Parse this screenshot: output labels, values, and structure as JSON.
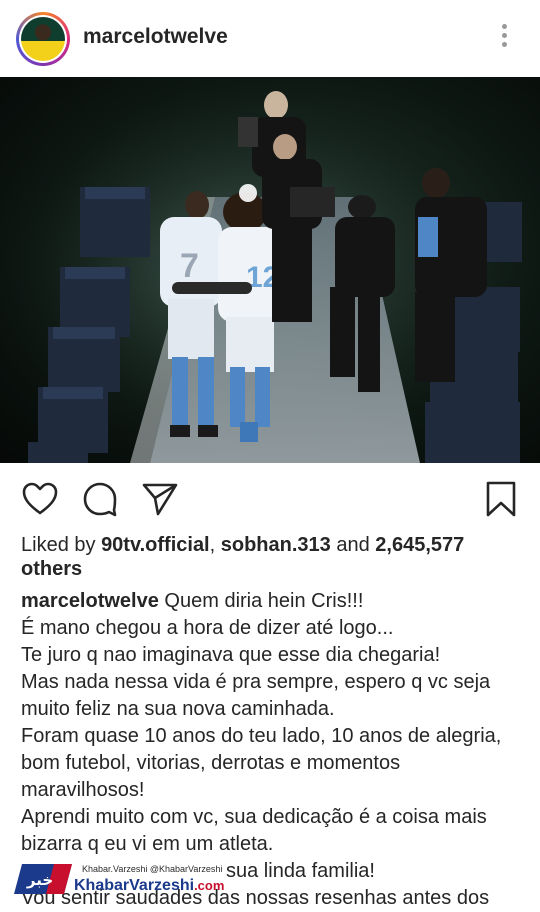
{
  "post": {
    "username": "marcelotwelve",
    "icons": {
      "more": "more-vertical-icon",
      "like": "heart-icon",
      "comment": "comment-icon",
      "share": "send-icon",
      "save": "bookmark-icon"
    },
    "likes": {
      "prefix": "Liked by ",
      "user1": "90tv.official",
      "sep": ", ",
      "user2": "sobhan.313",
      "mid": " and ",
      "count": "2,645,577",
      "suffix": "others"
    },
    "caption": {
      "username": "marcelotwelve",
      "lines": [
        "Quem diria hein Cris!!!",
        "É mano chegou a hora de dizer até logo...",
        "Te juro q nao imaginava que esse dia chegaria!",
        "Mas nada nessa vida é pra sempre, espero q vc seja",
        "muito feliz na sua nova caminhada.",
        "Foram quase 10 anos do teu lado, 10 anos de alegria,",
        "bom futebol, vitorias, derrotas e momentos",
        "maravilhosos!",
        "Aprendi muito com vc, sua dedicação é a coisa mais",
        "bizarra q eu vi em um atleta.",
        "sua linda familia!",
        "Vou sentir saudades das nossas resenhas antes dos"
      ]
    }
  },
  "watermark": {
    "handles": "Khabar.Varzeshi  @KhabarVarzeshi",
    "brand": "KhabarVarzeshi",
    "domain": ".com",
    "logo_text": "خبر"
  },
  "colors": {
    "text": "#262626",
    "muted": "#999999",
    "brand_blue": "#1b3a8c",
    "brand_red": "#c8102e"
  }
}
